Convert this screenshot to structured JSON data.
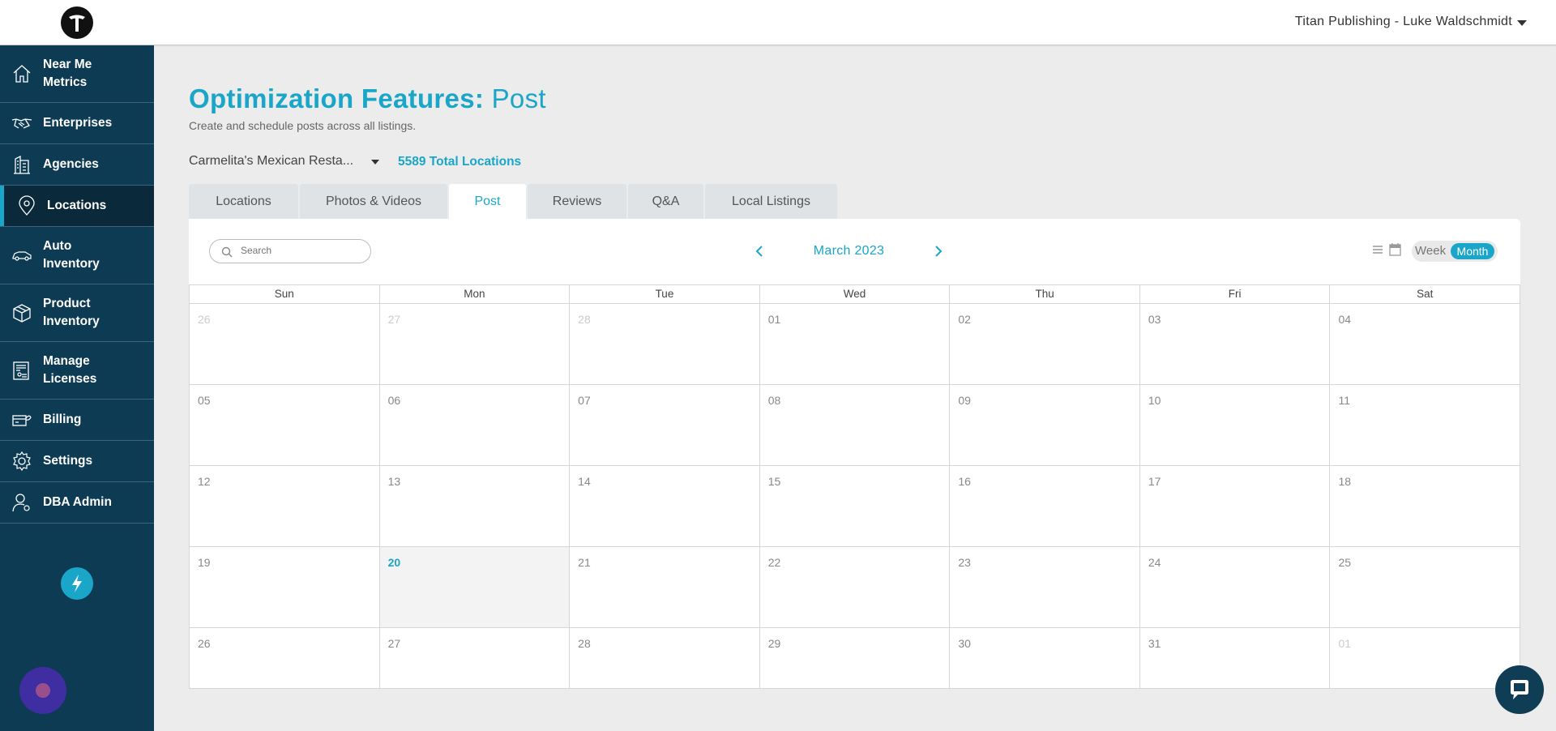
{
  "header": {
    "account": "Titan Publishing - Luke Waldschmidt"
  },
  "sidebar": {
    "items": [
      {
        "label1": "Near Me",
        "label2": "Metrics",
        "icon": "home-icon"
      },
      {
        "label1": "Enterprises",
        "label2": "",
        "icon": "handshake-icon"
      },
      {
        "label1": "Agencies",
        "label2": "",
        "icon": "building-icon"
      },
      {
        "label1": "Locations",
        "label2": "",
        "icon": "map-pin-icon"
      },
      {
        "label1": "Auto",
        "label2": "Inventory",
        "icon": "car-icon"
      },
      {
        "label1": "Product",
        "label2": "Inventory",
        "icon": "box-icon"
      },
      {
        "label1": "Manage",
        "label2": "Licenses",
        "icon": "license-icon"
      },
      {
        "label1": "Billing",
        "label2": "",
        "icon": "billing-icon"
      },
      {
        "label1": "Settings",
        "label2": "",
        "icon": "gear-icon"
      },
      {
        "label1": "DBA Admin",
        "label2": "",
        "icon": "admin-user-icon"
      }
    ],
    "active": "Locations"
  },
  "page": {
    "title_strong": "Optimization Features:",
    "title_light": "Post",
    "subtitle": "Create and schedule posts across all listings.",
    "location_select": "Carmelita's Mexican Resta...",
    "total_locations": "5589 Total Locations"
  },
  "tabs": [
    {
      "label": "Locations"
    },
    {
      "label": "Photos & Videos"
    },
    {
      "label": "Post"
    },
    {
      "label": "Reviews"
    },
    {
      "label": "Q&A"
    },
    {
      "label": "Local Listings"
    }
  ],
  "calendar": {
    "search_placeholder": "Search",
    "month_label": "March 2023",
    "view_week": "Week",
    "view_month": "Month",
    "days_of_week": [
      "Sun",
      "Mon",
      "Tue",
      "Wed",
      "Thu",
      "Fri",
      "Sat"
    ],
    "weeks": [
      [
        "26",
        "27",
        "28",
        "01",
        "02",
        "03",
        "04"
      ],
      [
        "05",
        "06",
        "07",
        "08",
        "09",
        "10",
        "11"
      ],
      [
        "12",
        "13",
        "14",
        "15",
        "16",
        "17",
        "18"
      ],
      [
        "19",
        "20",
        "21",
        "22",
        "23",
        "24",
        "25"
      ],
      [
        "26",
        "27",
        "28",
        "29",
        "30",
        "31",
        "01"
      ]
    ],
    "today": "20"
  },
  "colors": {
    "accent": "#1aa6c9",
    "sidebar": "#0d3b53",
    "sidebar_active": "#0a2a3b"
  }
}
